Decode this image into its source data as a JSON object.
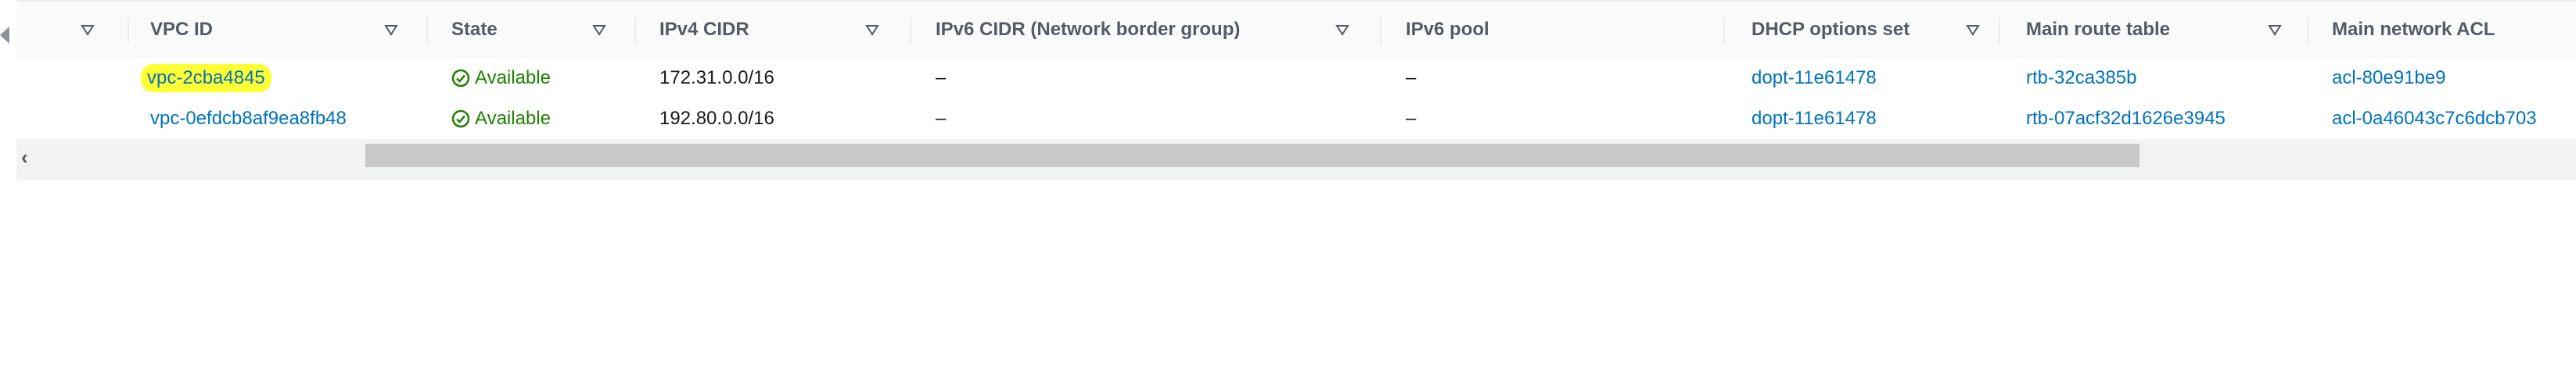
{
  "table": {
    "columns": [
      {
        "label": ""
      },
      {
        "label": "VPC ID"
      },
      {
        "label": "State"
      },
      {
        "label": "IPv4 CIDR"
      },
      {
        "label": "IPv6 CIDR (Network border group)"
      },
      {
        "label": "IPv6 pool"
      },
      {
        "label": "DHCP options set"
      },
      {
        "label": "Main route table"
      },
      {
        "label": "Main network ACL"
      }
    ],
    "rows": [
      {
        "vpc_id": "vpc-2cba4845",
        "state": "Available",
        "ipv4_cidr": "172.31.0.0/16",
        "ipv6_cidr": "–",
        "ipv6_pool": "–",
        "dhcp": "dopt-11e61478",
        "route_table": "rtb-32ca385b",
        "acl": "acl-80e91be9",
        "highlighted": true
      },
      {
        "vpc_id": "vpc-0efdcb8af9ea8fb48",
        "state": "Available",
        "ipv4_cidr": "192.80.0.0/16",
        "ipv6_cidr": "–",
        "ipv6_pool": "–",
        "dhcp": "dopt-11e61478",
        "route_table": "rtb-07acf32d1626e3945",
        "acl": "acl-0a46043c7c6dcb703",
        "highlighted": false
      }
    ]
  },
  "scrollbar": {
    "left_arrow": "‹"
  },
  "colors": {
    "link": "#0073bb",
    "success": "#1d8102",
    "highlight": "#ffff33"
  },
  "icons": {
    "filter": "filter-triangle-icon",
    "status": "check-circle-icon",
    "collapse": "collapse-left-icon"
  }
}
